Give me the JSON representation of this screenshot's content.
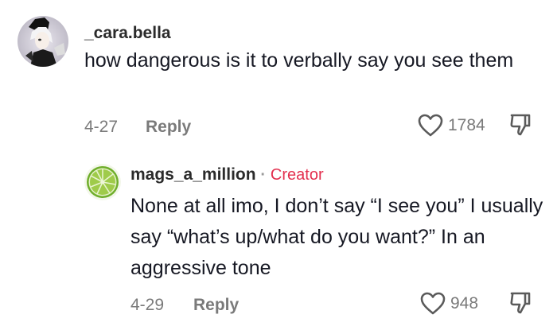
{
  "comments": [
    {
      "username": "_cara.bella",
      "text": "how dangerous is it to verbally say you see them",
      "date": "4-27",
      "reply_label": "Reply",
      "likes": "1784",
      "avatar_icon": "anime-character-avatar"
    },
    {
      "username": "mags_a_million",
      "separator": "·",
      "badge": "Creator",
      "text": "None at all imo, I don’t say “I see you” I usually say “what’s up/what do you want?” In an aggressive tone",
      "date": "4-29",
      "reply_label": "Reply",
      "likes": "948",
      "avatar_icon": "lime-slice-avatar"
    }
  ],
  "colors": {
    "creator_badge": "#e3304f",
    "meta_text": "#7a7a7a"
  }
}
